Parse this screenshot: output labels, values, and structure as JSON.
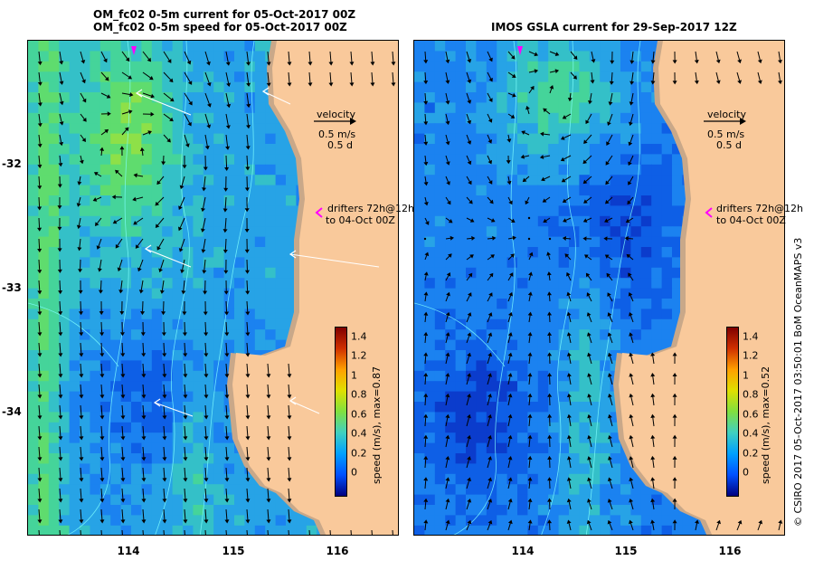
{
  "left_panel": {
    "title_line1": "OM_fc02 0-5m current for 05-Oct-2017 00Z",
    "title_line2": "OM_fc02 0-5m speed for 05-Oct-2017 00Z",
    "velocity_label": "velocity",
    "velocity_speed": "0.5 m/s",
    "velocity_days": "0.5 d",
    "drifters_line1": "drifters 72h@12h",
    "drifters_line2": "to 04-Oct 00Z",
    "colorbar_title": "speed (m/s), max=0.87",
    "max_speed": 0.87
  },
  "right_panel": {
    "title": "IMOS GSLA current for 29-Sep-2017 12Z",
    "velocity_label": "velocity",
    "velocity_speed": "0.5 m/s",
    "velocity_days": "0.5 d",
    "drifters_line1": "drifters 72h@12h",
    "drifters_line2": "to 04-Oct 00Z",
    "colorbar_title": "speed (m/s), max=0.52",
    "max_speed": 0.52
  },
  "axes": {
    "lon_ticks": [
      "114",
      "115",
      "116"
    ],
    "lat_ticks": [
      "-32",
      "-33",
      "-34"
    ]
  },
  "colorbar_ticks": [
    "1.4",
    "1.2",
    "1",
    "0.8",
    "0.6",
    "0.4",
    "0.2",
    "0"
  ],
  "credit": "© CSIRO 2017   05-Oct-2017 03:50:01 BoM OceanMAPS v3",
  "colors": {
    "land": "#f9c99b",
    "shelf": "#c9a889",
    "drifter_track": "#ffffff",
    "drifter_marker": "#ff00ff",
    "contour": "#7fffff"
  }
}
